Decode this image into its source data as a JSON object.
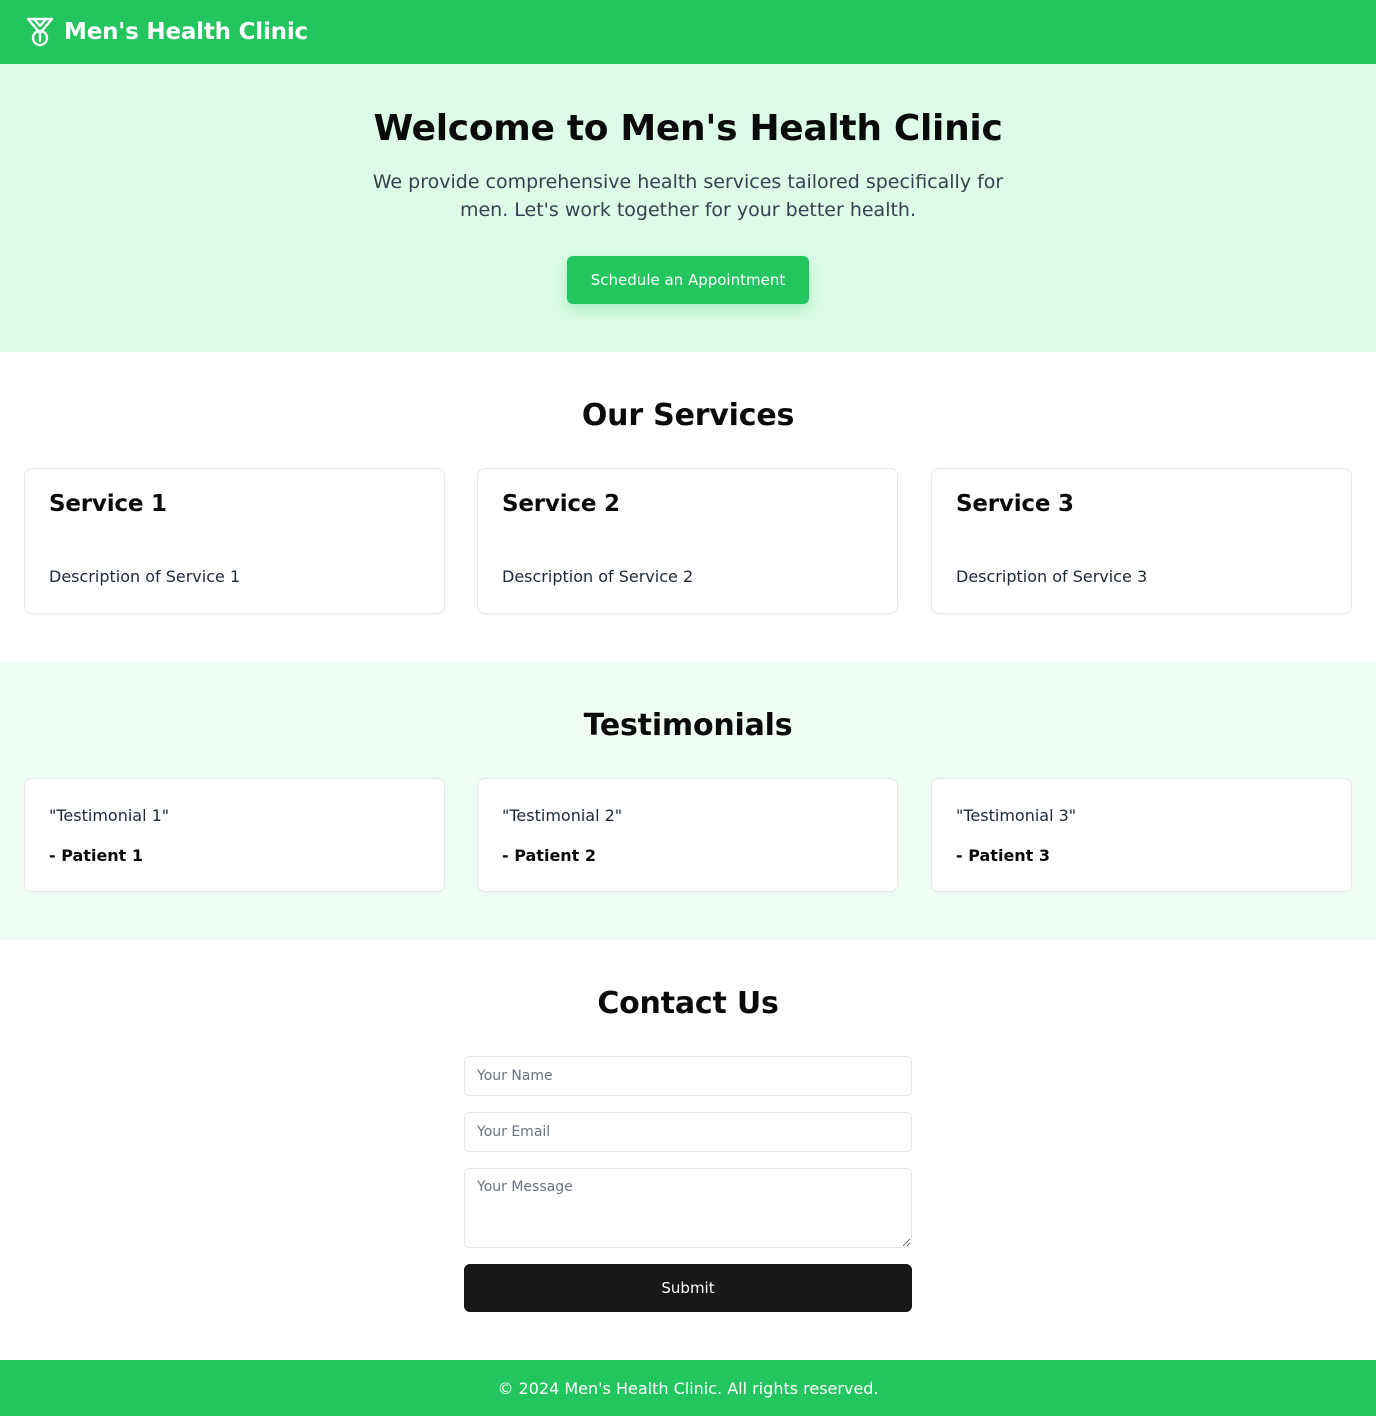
{
  "header": {
    "logo_icon": "medal-icon",
    "brand": "Men's Health Clinic"
  },
  "hero": {
    "title": "Welcome to Men's Health Clinic",
    "subtitle": "We provide comprehensive health services tailored specifically for men. Let's work together for your better health.",
    "cta_label": "Schedule an Appointment"
  },
  "services": {
    "heading": "Our Services",
    "items": [
      {
        "title": "Service 1",
        "description": "Description of Service 1"
      },
      {
        "title": "Service 2",
        "description": "Description of Service 2"
      },
      {
        "title": "Service 3",
        "description": "Description of Service 3"
      }
    ]
  },
  "testimonials": {
    "heading": "Testimonials",
    "items": [
      {
        "quote": "\"Testimonial 1\"",
        "author": "- Patient 1"
      },
      {
        "quote": "\"Testimonial 2\"",
        "author": "- Patient 2"
      },
      {
        "quote": "\"Testimonial 3\"",
        "author": "- Patient 3"
      }
    ]
  },
  "contact": {
    "heading": "Contact Us",
    "name_placeholder": "Your Name",
    "email_placeholder": "Your Email",
    "message_placeholder": "Your Message",
    "submit_label": "Submit"
  },
  "footer": {
    "text": "© 2024 Men's Health Clinic. All rights reserved."
  },
  "colors": {
    "brand_green": "#22c55e",
    "hero_bg": "#dcfce7",
    "testimonials_bg": "#f0fdf4",
    "submit_bg": "#18181b"
  }
}
